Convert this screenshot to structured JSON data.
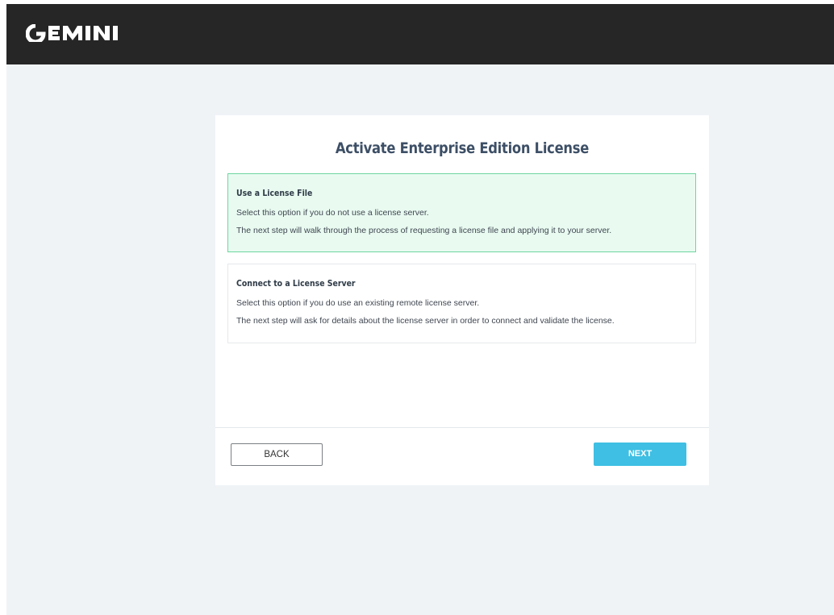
{
  "header": {
    "logo_text": "GEMINI",
    "logo_icon": "gemini-logo-icon",
    "background_color": "#262626"
  },
  "dialog": {
    "title": "Activate Enterprise Edition License",
    "options": [
      {
        "heading": "Use a License File",
        "line1": "Select this option if you do not use a license server.",
        "line2": "The next step will walk through the process of requesting a license file and applying it to your server.",
        "selected": true
      },
      {
        "heading": "Connect to a License Server",
        "line1": "Select this option if you do use an existing remote license server.",
        "line2": "The next step will ask for details about the license server in order to connect and validate the license.",
        "selected": false
      }
    ],
    "back_label": "BACK",
    "next_label": "NEXT"
  },
  "colors": {
    "page_background": "#f0f3f6",
    "selected_option_background": "#e9fbf1",
    "selected_option_border": "#6fd4a0",
    "title_color": "#3d4f66",
    "next_button": "#3ebfe3"
  }
}
